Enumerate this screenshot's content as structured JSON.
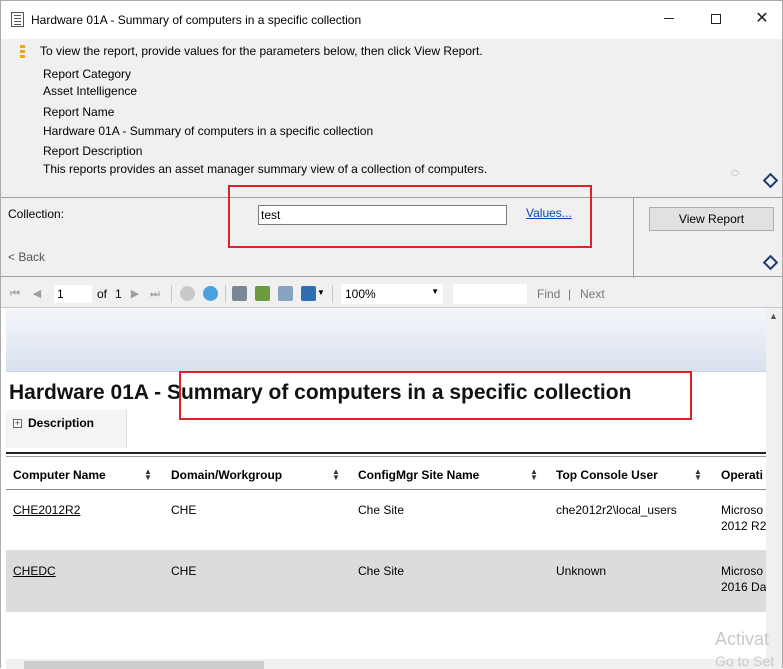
{
  "window": {
    "title": "Hardware 01A - Summary of computers in a specific collection",
    "minimize_symbol": "",
    "close_symbol": "✕"
  },
  "info": {
    "instruction": "To view the report, provide values for the parameters below, then click View Report.",
    "category_label": "Report Category",
    "category_value": "Asset Intelligence",
    "name_label": "Report Name",
    "name_value": "Hardware 01A - Summary of computers in a specific collection",
    "description_label": "Report Description",
    "description_value": "This reports provides an asset manager summary view of a collection of computers."
  },
  "params": {
    "collection_label": "Collection:",
    "collection_value": "test",
    "values_link": "Values...",
    "back_label": "< Back",
    "view_report_label": "View Report"
  },
  "toolbar": {
    "page_current": "1",
    "page_of_label": "of",
    "page_total": "1",
    "zoom": "100%",
    "find_label": "Find",
    "separator": "|",
    "next_label": "Next"
  },
  "report": {
    "title_prefix": "Hardware 01A - ",
    "title_main": "Summary of computers in a specific collection",
    "description_toggle": "Description",
    "columns": [
      "Computer Name",
      "Domain/Workgroup",
      "ConfigMgr Site Name",
      "Top Console User",
      "Operati"
    ],
    "rows": [
      {
        "computer": "CHE2012R2",
        "domain": "CHE",
        "site": "Che Site",
        "user": "che2012r2\\local_users",
        "os_line1": "Microso",
        "os_line2": "2012 R2"
      },
      {
        "computer": "CHEDC",
        "domain": "CHE",
        "site": "Che Site",
        "user": "Unknown",
        "os_line1": "Microso",
        "os_line2": "2016 Da"
      }
    ]
  },
  "watermark": {
    "line1": "Activat",
    "line2": "Go to Set"
  },
  "colors": {
    "highlight_box": "#e0202a",
    "link": "#0645ad",
    "alt_row": "#dcdcdc"
  }
}
